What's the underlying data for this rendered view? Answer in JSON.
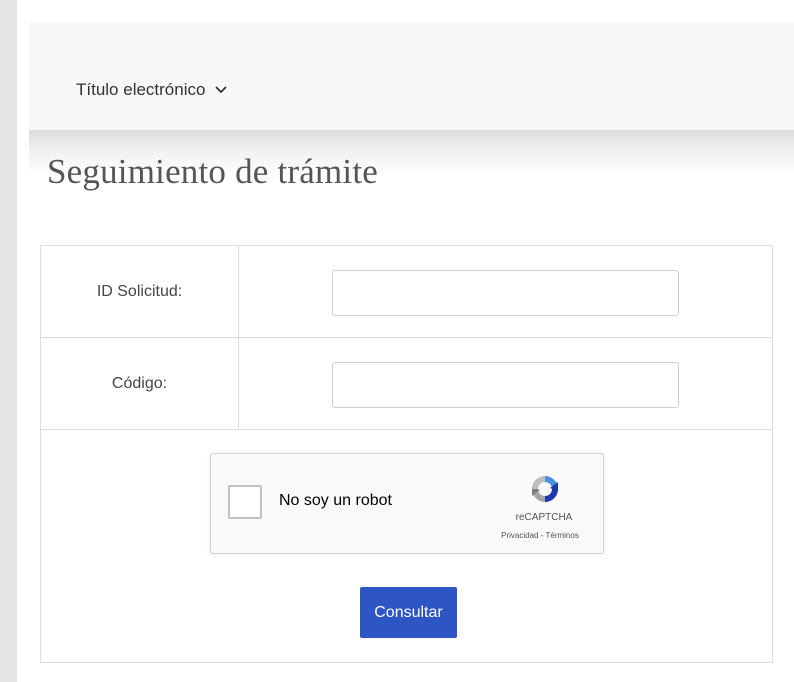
{
  "nav": {
    "menu_label": "Título electrónico"
  },
  "page": {
    "title": "Seguimiento de trámite"
  },
  "form": {
    "id_label": "ID Solicitud:",
    "id_value": "",
    "code_label": "Código:",
    "code_value": "",
    "submit_label": "Consultar"
  },
  "recaptcha": {
    "checkbox_label": "No soy un robot",
    "brand": "reCAPTCHA",
    "privacy_link": "Privacidad",
    "separator": " - ",
    "terms_link": "Términos",
    "checked": false
  },
  "colors": {
    "primary_button": "#2d55c4",
    "page_background": "#e6e6e6",
    "nav_background": "#f6f7f9"
  },
  "icons": {
    "menu_chevron": "chevron-down-icon",
    "recaptcha_logo": "recaptcha-logo-icon"
  }
}
